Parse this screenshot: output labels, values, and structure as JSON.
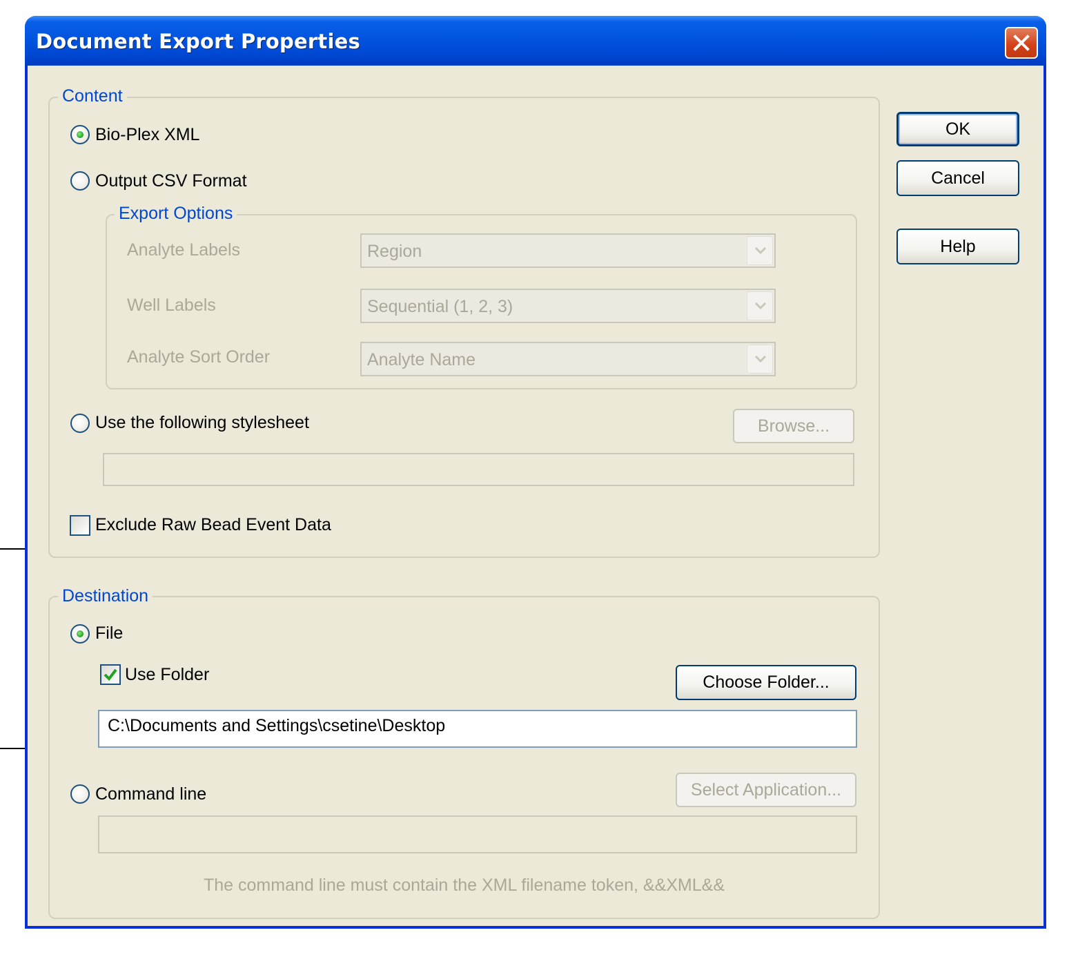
{
  "window": {
    "title": "Document Export Properties"
  },
  "buttons": {
    "ok": "OK",
    "cancel": "Cancel",
    "help": "Help"
  },
  "content": {
    "legend": "Content",
    "bioplex_xml": {
      "label": "Bio-Plex XML",
      "selected": true
    },
    "output_csv": {
      "label": "Output CSV Format",
      "selected": false
    },
    "export_options": {
      "legend": "Export Options",
      "analyte_labels": {
        "label": "Analyte Labels",
        "value": "Region"
      },
      "well_labels": {
        "label": "Well Labels",
        "value": "Sequential (1, 2, 3)"
      },
      "analyte_sort_order": {
        "label": "Analyte Sort Order",
        "value": "Analyte Name"
      }
    },
    "stylesheet": {
      "label": "Use the following stylesheet",
      "selected": false,
      "browse_label": "Browse...",
      "value": ""
    },
    "exclude_raw": {
      "label": "Exclude Raw Bead Event Data",
      "checked": false
    }
  },
  "destination": {
    "legend": "Destination",
    "file": {
      "label": "File",
      "selected": true
    },
    "use_folder": {
      "label": "Use Folder",
      "checked": true
    },
    "choose_folder_label": "Choose Folder...",
    "folder_path": "C:\\Documents and Settings\\csetine\\Desktop",
    "command_line": {
      "label": "Command line",
      "selected": false,
      "value": ""
    },
    "select_application_label": "Select Application...",
    "note": "The command line must contain the XML filename token, &&XML&&"
  },
  "colors": {
    "title_bar": "#0054e3",
    "dialog_bg": "#ece9d8",
    "group_legend": "#0046d5",
    "disabled_text": "#aca899"
  }
}
